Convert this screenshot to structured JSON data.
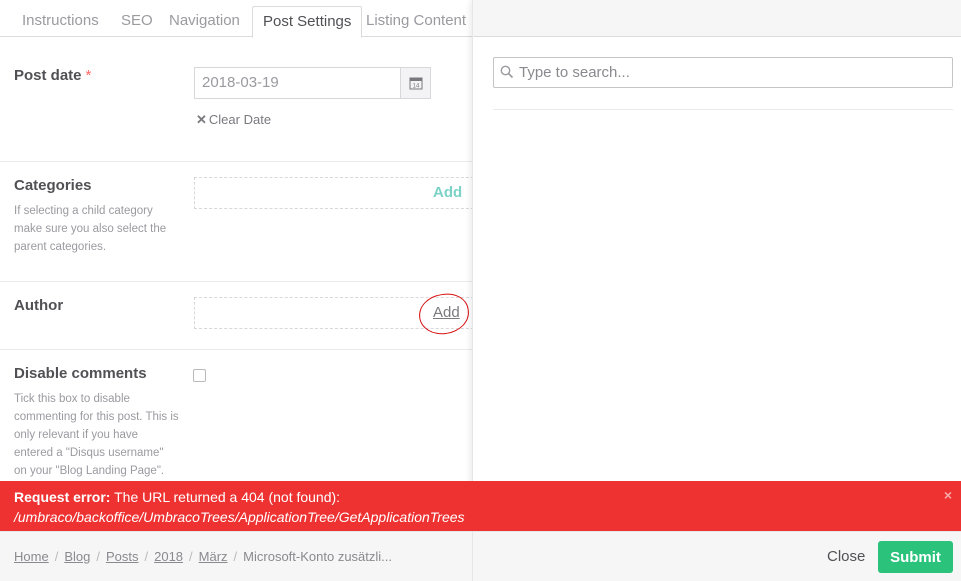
{
  "tabs": [
    {
      "label": "Instructions"
    },
    {
      "label": "SEO"
    },
    {
      "label": "Navigation"
    },
    {
      "label": "Post Settings",
      "active": true
    },
    {
      "label": "Listing Content"
    }
  ],
  "post_date": {
    "label": "Post date",
    "required_mark": "*",
    "value": "2018-03-19",
    "calendar_day": "14",
    "clear_label": "Clear Date"
  },
  "categories": {
    "label": "Categories",
    "description": "If selecting a child category make sure you also select the parent categories.",
    "add_label": "Add"
  },
  "author": {
    "label": "Author",
    "add_label": "Add"
  },
  "disable_comments": {
    "label": "Disable comments",
    "description": "Tick this box to disable commenting for this post. This is only relevant if you have entered a \"Disqus username\" on your \"Blog Landing Page\".",
    "checked": false
  },
  "overlay": {
    "search_placeholder": "Type to search..."
  },
  "error": {
    "prefix": "Request error:",
    "message": "The URL returned a 404 (not found):",
    "path": "/umbraco/backoffice/UmbracoTrees/ApplicationTree/GetApplicationTrees",
    "close_glyph": "×"
  },
  "breadcrumb": {
    "items": [
      "Home",
      "Blog",
      "Posts",
      "2018",
      "März"
    ],
    "current": "Microsoft-Konto zusätzli..."
  },
  "footer": {
    "close_label": "Close",
    "submit_label": "Submit"
  },
  "colors": {
    "error": "#ee3131",
    "submit": "#2bc37c",
    "add_link": "#7bd2c7",
    "annotation": "#d81010"
  }
}
